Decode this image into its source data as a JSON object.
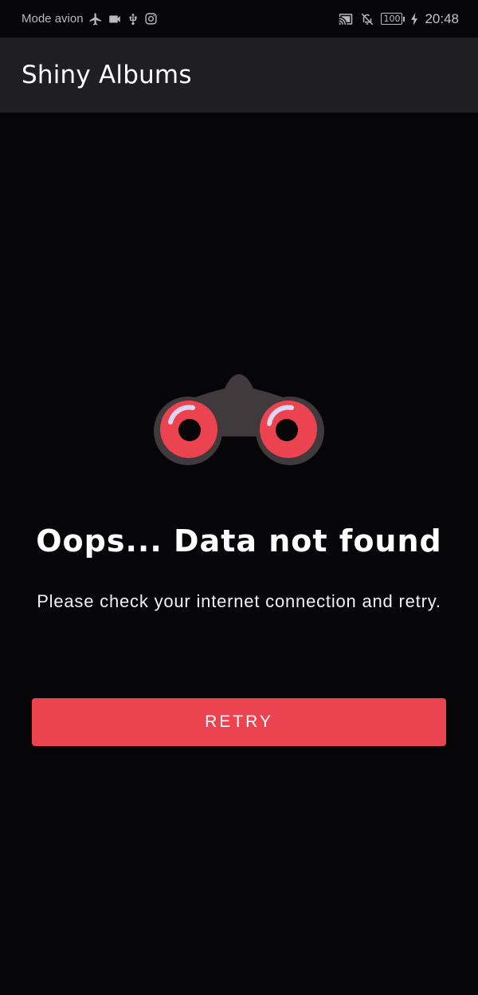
{
  "status_bar": {
    "carrier_text": "Mode avion",
    "battery_level": "100",
    "time": "20:48",
    "left_icons": [
      "airplane-icon",
      "video-camera-icon",
      "usb-icon",
      "instagram-icon"
    ],
    "right_icons": [
      "cast-icon",
      "notifications-off-icon",
      "battery-icon",
      "charging-icon"
    ]
  },
  "app_bar": {
    "title": "Shiny Albums"
  },
  "error": {
    "illustration": "binoculars-icon",
    "title": "Oops... Data not found",
    "message": "Please check your internet connection and retry."
  },
  "retry_button": {
    "label": "RETRY"
  },
  "colors": {
    "background": "#060507",
    "app_bar": "#1f1e20",
    "accent": "#ec4350",
    "binocular_body": "#403a3d",
    "lens": "#ec4350",
    "highlight": "#ddd6f0"
  }
}
